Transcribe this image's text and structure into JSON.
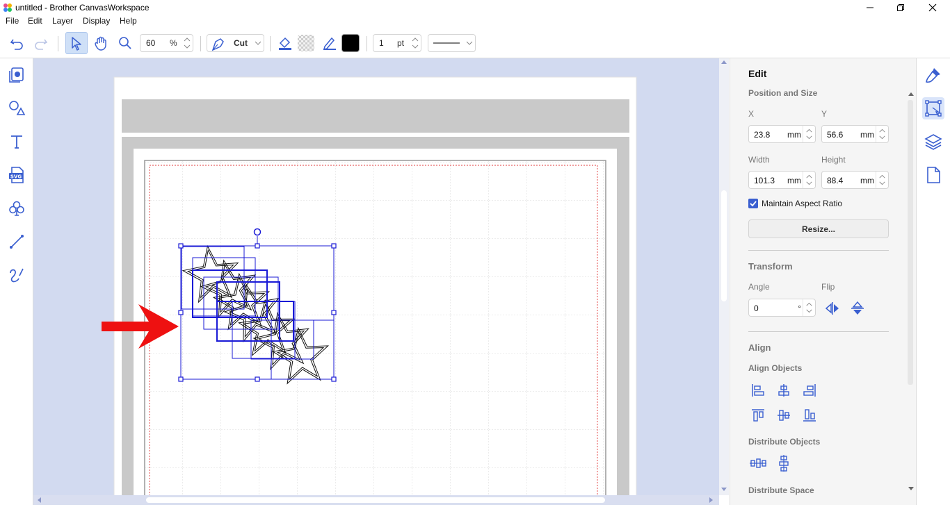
{
  "window": {
    "title": "untitled - Brother CanvasWorkspace",
    "minimize_icon": "minimize-icon",
    "restore_icon": "restore-icon",
    "close_icon": "close-icon"
  },
  "menu": [
    "File",
    "Edit",
    "Layer",
    "Display",
    "Help"
  ],
  "toolbar": {
    "zoom_value": "60",
    "zoom_unit": "%",
    "mode_label": "Cut",
    "line_width_value": "1",
    "line_width_unit": "pt",
    "fill_color": "#000000"
  },
  "panel": {
    "title": "Edit",
    "position_size": {
      "heading": "Position and Size",
      "x_label": "X",
      "x_value": "23.8",
      "x_unit": "mm",
      "y_label": "Y",
      "y_value": "56.6",
      "y_unit": "mm",
      "width_label": "Width",
      "width_value": "101.3",
      "width_unit": "mm",
      "height_label": "Height",
      "height_value": "88.4",
      "height_unit": "mm",
      "aspect_label": "Maintain Aspect Ratio",
      "aspect_checked": true,
      "resize_label": "Resize..."
    },
    "transform": {
      "heading": "Transform",
      "angle_label": "Angle",
      "angle_value": "0",
      "angle_unit": "°",
      "flip_label": "Flip"
    },
    "align": {
      "heading": "Align",
      "align_objects_label": "Align Objects",
      "distribute_objects_label": "Distribute Objects",
      "distribute_space_label": "Distribute Space"
    }
  },
  "colors": {
    "accent": "#3a5fd0",
    "selection": "#1a1ad6",
    "canvas_bg": "#d2daf0",
    "arrow": "#ee1111"
  }
}
